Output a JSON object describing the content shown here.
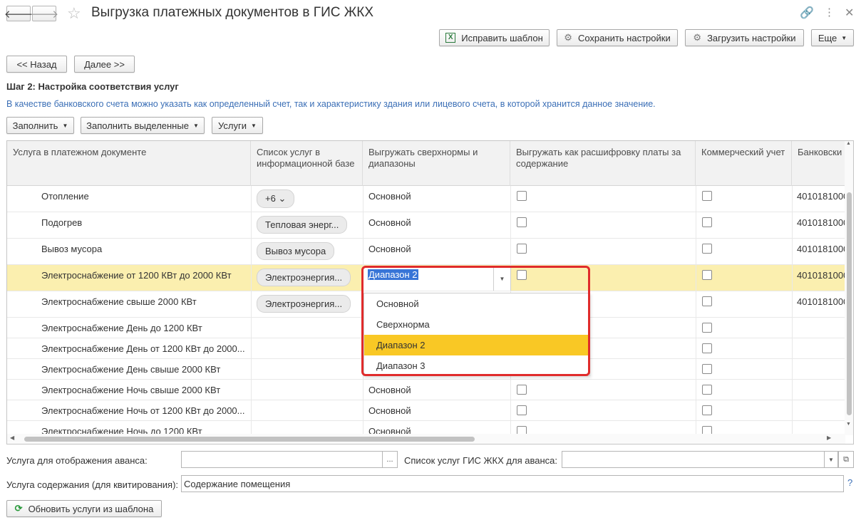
{
  "window": {
    "title": "Выгрузка платежных документов в ГИС ЖКХ",
    "back_icon": "arrow-left-icon",
    "forward_icon": "arrow-right-icon"
  },
  "toolbar_top": {
    "fix_template": "Исправить шаблон",
    "save_settings": "Сохранить настройки",
    "load_settings": "Загрузить настройки",
    "more": "Еще"
  },
  "wizard": {
    "back": "<< Назад",
    "next": "Далее >>"
  },
  "step": {
    "title": "Шаг 2: Настройка соответствия услуг",
    "hint": "В качестве банковского счета можно указать как определенный счет, так и характеристику здания или лицевого счета, в которой хранится данное значение."
  },
  "grid_toolbar": {
    "fill": "Заполнить",
    "fill_selected": "Заполнить выделенные",
    "services": "Услуги"
  },
  "table": {
    "columns": [
      "Услуга в платежном документе",
      "Список услуг в информационной базе",
      "Выгружать сверхнормы и диапазоны",
      "Выгружать как расшифровку платы за содержание",
      "Коммерческий учет",
      "Банковски"
    ],
    "rows": [
      {
        "service": "Отопление",
        "list": "+6",
        "list_type": "more",
        "mode": "Основной",
        "show_cb": true,
        "acct": "4010181000"
      },
      {
        "service": "Подогрев",
        "list": "Тепловая энерг...",
        "list_type": "chip",
        "mode": "Основной",
        "show_cb": true,
        "acct": "4010181000"
      },
      {
        "service": "Вывоз мусора",
        "list": "Вывоз мусора",
        "list_type": "chip",
        "mode": "Основной",
        "show_cb": true,
        "acct": "4010181000"
      },
      {
        "service": "Электроснабжение от 1200 КВт до 2000 КВт",
        "list": "Электроэнергия...",
        "list_type": "chip",
        "mode": "",
        "show_cb": true,
        "acct": "4010181000"
      },
      {
        "service": "Электроснабжение свыше 2000 КВт",
        "list": "Электроэнергия...",
        "list_type": "chip",
        "mode": "",
        "show_cb": false,
        "acct": "4010181000"
      },
      {
        "service": "Электроснабжение День до 1200 КВт",
        "list": "",
        "list_type": "none",
        "mode": "",
        "show_cb": false,
        "acct": ""
      },
      {
        "service": "Электроснабжение День от 1200 КВт до 2000...",
        "list": "",
        "list_type": "none",
        "mode": "",
        "show_cb": false,
        "acct": ""
      },
      {
        "service": "Электроснабжение День свыше 2000 КВт",
        "list": "",
        "list_type": "none",
        "mode": "",
        "show_cb": false,
        "acct": ""
      },
      {
        "service": "Электроснабжение Ночь свыше 2000 КВт",
        "list": "",
        "list_type": "none",
        "mode": "Основной",
        "show_cb": true,
        "acct": ""
      },
      {
        "service": "Электроснабжение Ночь от 1200 КВт до 2000...",
        "list": "",
        "list_type": "none",
        "mode": "Основной",
        "show_cb": true,
        "acct": ""
      },
      {
        "service": "Электроснабжение Ночь до 1200 КВт",
        "list": "",
        "list_type": "none",
        "mode": "Основной",
        "show_cb": true,
        "acct": ""
      }
    ],
    "selected_row": 3
  },
  "dropdown": {
    "current_value": "Диапазон 2",
    "options": [
      "Основной",
      "Сверхнорма",
      "Диапазон 2",
      "Диапазон 3"
    ],
    "active_index": 2,
    "highlight_color": "#f9c825",
    "frame_color": "#e02b2b"
  },
  "bottom": {
    "advance_service_label": "Услуга для отображения аванса:",
    "advance_service_value": "",
    "advance_choose": "...",
    "gis_list_label": "Список услуг ГИС ЖКХ для аванса:",
    "gis_list_value": "",
    "maintenance_label": "Услуга содержания (для квитирования):",
    "maintenance_value": "Содержание помещения",
    "help": "?",
    "refresh_button": "Обновить услуги из шаблона"
  }
}
